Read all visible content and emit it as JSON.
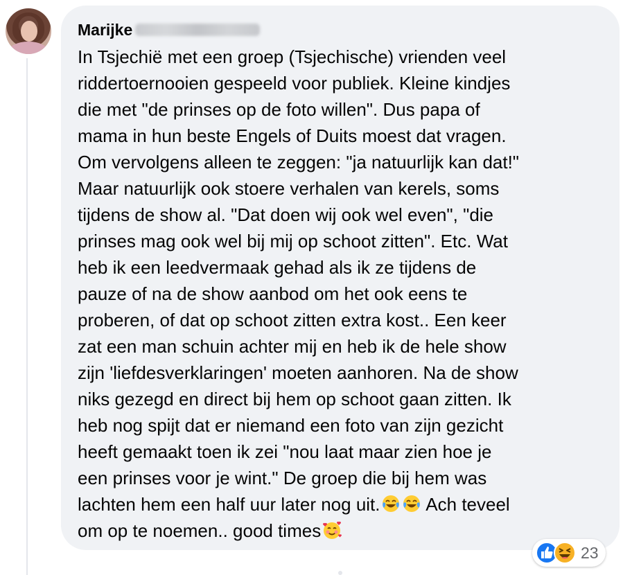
{
  "comment": {
    "author": "Marijke",
    "lines": [
      "In Tsjechië met een groep (Tsjechische) vrienden veel",
      "riddertoernooien gespeeld voor publiek. Kleine kindjes",
      "die met \"de prinses op de foto willen\". Dus papa of",
      "mama in hun beste Engels of Duits moest dat vragen.",
      "Om vervolgens alleen te zeggen: \"ja natuurlijk kan dat!\"",
      "Maar natuurlijk ook stoere verhalen van kerels, soms",
      "tijdens de show al. \"Dat doen wij ook wel even\", \"die",
      "prinses mag ook wel bij mij op schoot zitten\". Etc. Wat",
      "heb ik een leedvermaak gehad als ik ze tijdens de",
      "pauze of na de show aanbod om het ook eens te",
      "proberen, of dat op schoot zitten extra kost.. Een keer",
      "zat een man schuin achter mij en heb ik de hele show",
      "zijn 'liefdesverklaringen' moeten aanhoren. Na de show",
      "niks gezegd en direct bij hem op schoot gaan zitten. Ik",
      "heb nog spijt dat er niemand een foto van zijn gezicht",
      "heeft gemaakt toen ik zei \"nou laat maar zien hoe je",
      "een prinses voor je wint.\" De groep die bij hem was"
    ],
    "line_17_before_emoji": "lachten hem een half uur later nog uit.",
    "line_17_after_emoji": " Ach teveel",
    "line_18_before_emoji": "om op te noemen.. good times",
    "emojis": [
      "tears-of-joy-emoji",
      "tears-of-joy-emoji",
      "smiling-face-with-hearts-emoji"
    ]
  },
  "reactions": {
    "icons": [
      "like-icon",
      "haha-icon"
    ],
    "count": "23"
  },
  "colors": {
    "bubble": "#f0f2f5",
    "text": "#050505",
    "secondary": "#65676b",
    "like_blue": "#1877f2",
    "haha_yellow": "#f7b125"
  }
}
